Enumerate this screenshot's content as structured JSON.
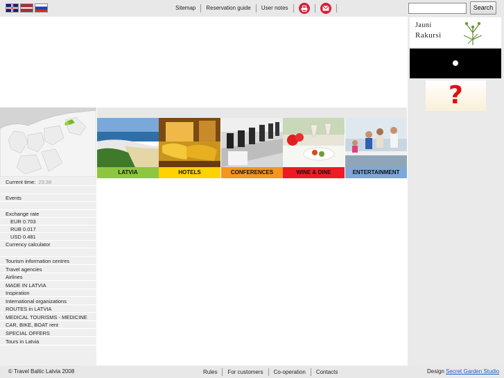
{
  "language_flags": [
    {
      "icon": "flag-uk-icon",
      "language": "English"
    },
    {
      "icon": "flag-latvia-icon",
      "language": "Latvian"
    },
    {
      "icon": "flag-russia-icon",
      "language": "Russian"
    }
  ],
  "top_nav": {
    "sitemap": "Sitemap",
    "reservation_guide": "Reservation guide",
    "user_notes": "User notes",
    "print_icon": "print-icon",
    "email_icon": "email-icon"
  },
  "search": {
    "value": "",
    "button_label": "Search"
  },
  "banners": {
    "jauni_rakursi_line1": "Jauni",
    "jauni_rakursi_line2": "Rakursi",
    "question_icon": "question-mark-icon"
  },
  "sidebar": {
    "current_time_label": "Current time:",
    "current_time_value": "23:38",
    "events": "Events",
    "exchange_rate_label": "Exchange rate",
    "rates": [
      {
        "currency": "EUR",
        "value": "0.703"
      },
      {
        "currency": "RUB",
        "value": "0.017"
      },
      {
        "currency": "USD",
        "value": "0.481"
      }
    ],
    "currency_calculator": "Currency calculator",
    "links": [
      "Tourism information centres",
      "Travel agencies",
      "Airlines",
      "MADE IN LATVIA",
      "Inspiration",
      "International organizations",
      "ROUTES in LATVIA",
      "MEDICAL TOURISMS - MEDICINE",
      "CAR, BIKE, BOAT rent",
      "SPECIAL OFFERS",
      "Tours in Latvia"
    ]
  },
  "categories": [
    {
      "label": "LATVIA",
      "color": "#8ec63f"
    },
    {
      "label": "HOTELS",
      "color": "#ffd200"
    },
    {
      "label": "CONFERENCES",
      "color": "#f7941d"
    },
    {
      "label": "WINE & DINE",
      "color": "#ed1c24"
    },
    {
      "label": "ENTERTAINMENT",
      "color": "#7fa7d9"
    }
  ],
  "footer": {
    "copyright": "© Travel Baltic Latvia 2008",
    "links": [
      "Rules",
      "For customers",
      "Co-operation",
      "Contacts"
    ],
    "design_label": "Design",
    "design_link": "Secret Garden Studio"
  }
}
